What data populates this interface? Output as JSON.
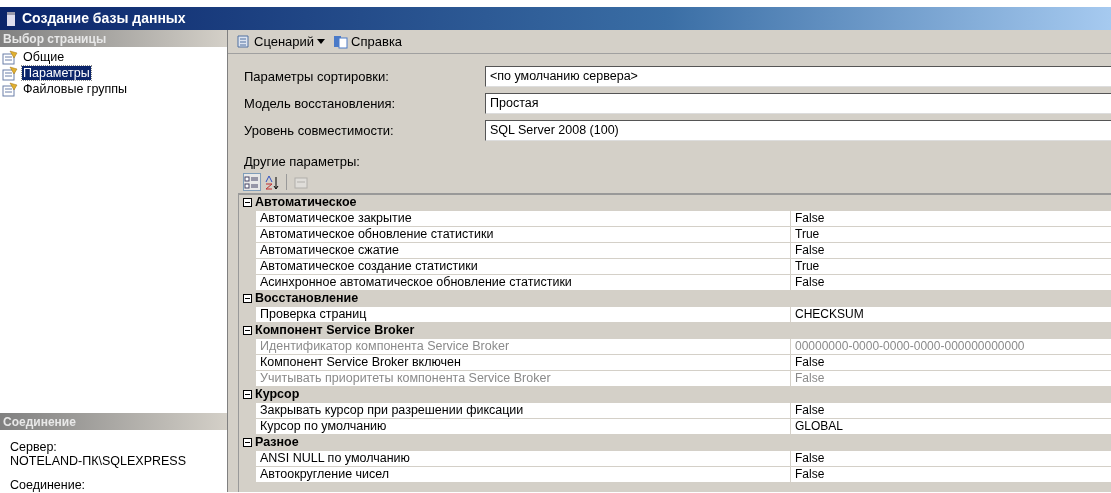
{
  "window": {
    "title": "Создание базы данных"
  },
  "page_selector": {
    "header": "Выбор страницы",
    "items": [
      {
        "label": "Общие",
        "selected": false
      },
      {
        "label": "Параметры",
        "selected": true
      },
      {
        "label": "Файловые группы",
        "selected": false
      }
    ]
  },
  "connection": {
    "header": "Соединение",
    "entries": [
      {
        "label": "Сервер:",
        "value": "NOTELAND-ПК\\SQLEXPRESS"
      },
      {
        "label": "Соединение:"
      }
    ]
  },
  "toolbar": [
    {
      "kind": "script",
      "label": "Сценарий"
    },
    {
      "kind": "help",
      "label": "Справка"
    }
  ],
  "fields": [
    {
      "label": "Параметры сортировки:",
      "value": "<по умолчанию сервера>"
    },
    {
      "label": "Модель восстановления:",
      "value": "Простая"
    },
    {
      "label": "Уровень совместимости:",
      "value": "SQL Server 2008 (100)"
    }
  ],
  "other_label": "Другие параметры:",
  "grid_buttons": [
    {
      "kind": "categorized",
      "selected": true,
      "disabled": false
    },
    {
      "kind": "alphabetical",
      "selected": false,
      "disabled": false
    },
    {
      "kind": "pages",
      "selected": false,
      "disabled": true
    }
  ],
  "groups": [
    {
      "name": "Автоматическое",
      "expanded": true,
      "rows": [
        {
          "name": "Автоматическое закрытие",
          "value": "False",
          "disabled": false
        },
        {
          "name": "Автоматическое обновление статистики",
          "value": "True",
          "disabled": false
        },
        {
          "name": "Автоматическое сжатие",
          "value": "False",
          "disabled": false
        },
        {
          "name": "Автоматическое создание статистики",
          "value": "True",
          "disabled": false
        },
        {
          "name": "Асинхронное автоматическое обновление статистики",
          "value": "False",
          "disabled": false
        }
      ]
    },
    {
      "name": "Восстановление",
      "expanded": true,
      "rows": [
        {
          "name": "Проверка страниц",
          "value": "CHECKSUM",
          "disabled": false
        }
      ]
    },
    {
      "name": "Компонент Service Broker",
      "expanded": true,
      "rows": [
        {
          "name": "Идентификатор компонента Service Broker",
          "value": "00000000-0000-0000-0000-000000000000",
          "disabled": true
        },
        {
          "name": "Компонент Service Broker включен",
          "value": "False",
          "disabled": false
        },
        {
          "name": "Учитывать приоритеты компонента Service Broker",
          "value": "False",
          "disabled": true
        }
      ]
    },
    {
      "name": "Курсор",
      "expanded": true,
      "rows": [
        {
          "name": "Закрывать курсор при разрешении фиксации",
          "value": "False",
          "disabled": false
        },
        {
          "name": "Курсор по умолчанию",
          "value": "GLOBAL",
          "disabled": false
        }
      ]
    },
    {
      "name": "Разное",
      "expanded": true,
      "rows": [
        {
          "name": "ANSI NULL по умолчанию",
          "value": "False",
          "disabled": false
        },
        {
          "name": "Автоокругление чисел",
          "value": "False",
          "disabled": false
        }
      ]
    }
  ]
}
